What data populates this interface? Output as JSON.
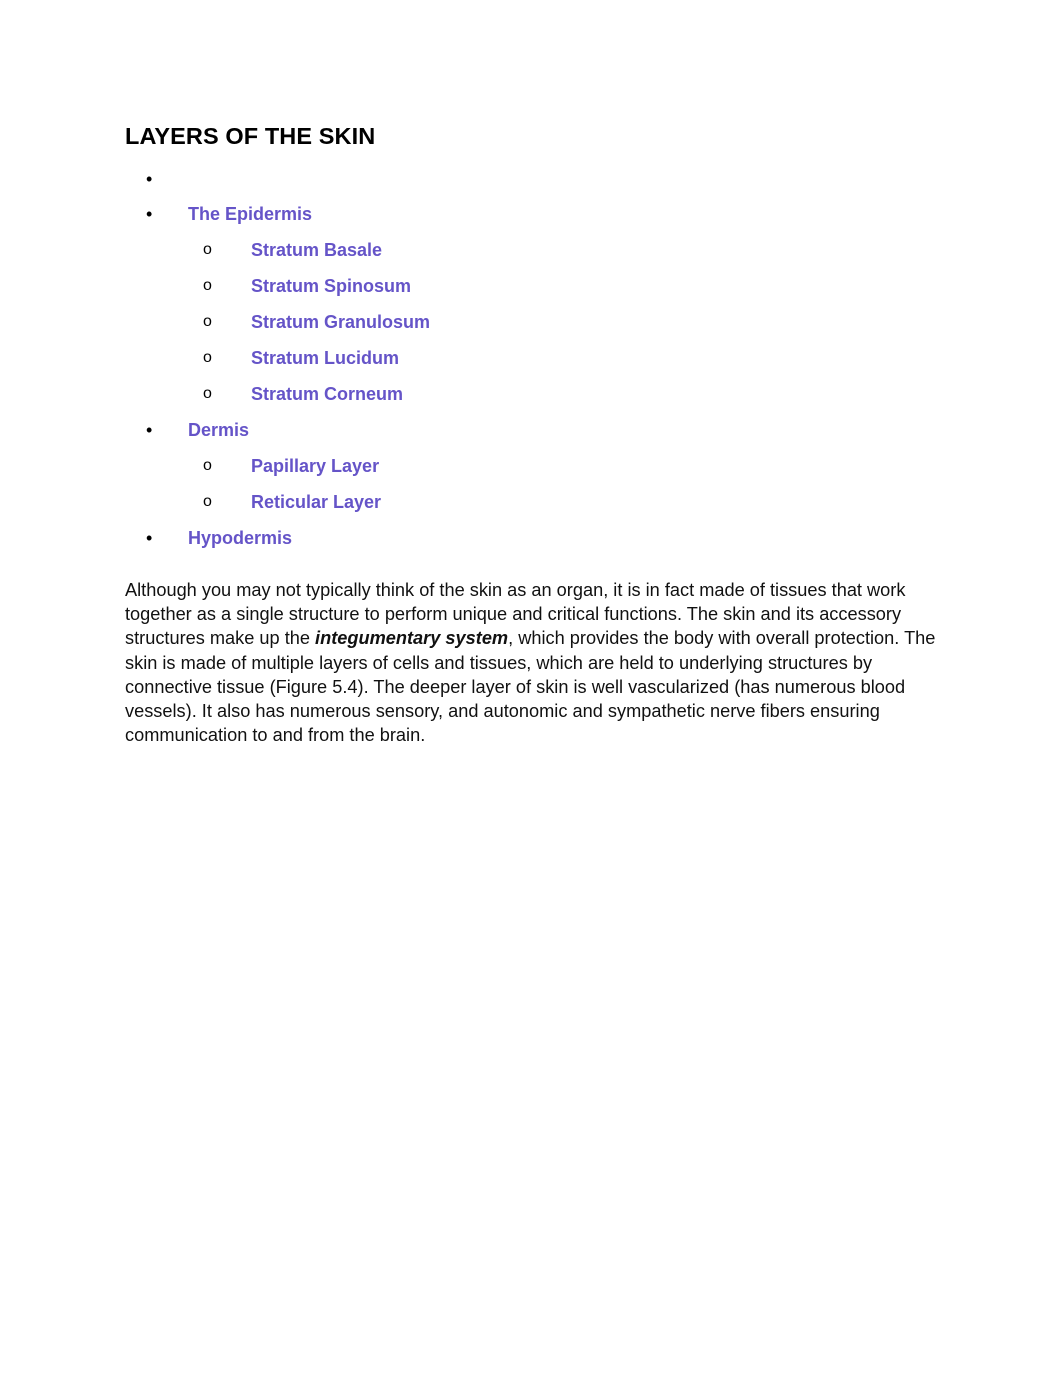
{
  "document": {
    "title": "LAYERS OF THE SKIN",
    "link_color": "#6554C8",
    "text_color": "#111111"
  },
  "outline": {
    "items": [
      {
        "marker": "•",
        "label": "",
        "is_link": false,
        "children": []
      },
      {
        "marker": "•",
        "label": "The Epidermis",
        "is_link": true,
        "children": [
          {
            "marker": "o",
            "label": "Stratum Basale"
          },
          {
            "marker": "o",
            "label": "Stratum Spinosum"
          },
          {
            "marker": "o",
            "label": "Stratum Granulosum"
          },
          {
            "marker": "o",
            "label": "Stratum Lucidum"
          },
          {
            "marker": "o",
            "label": "Stratum Corneum"
          }
        ]
      },
      {
        "marker": "•",
        "label": "Dermis",
        "is_link": true,
        "children": [
          {
            "marker": "o",
            "label": "Papillary Layer"
          },
          {
            "marker": "o",
            "label": "Reticular Layer"
          }
        ]
      },
      {
        "marker": "•",
        "label": "Hypodermis",
        "is_link": true,
        "children": []
      }
    ]
  },
  "paragraph": {
    "part1": "Although you may not typically think of the skin as an organ, it is in fact made of tissues that work together as a single structure to perform unique and critical functions. The skin and its accessory structures make up the ",
    "emphasis": "integumentary system",
    "part2": ", which provides the body with overall protection. The skin is made of multiple layers of cells and tissues, which are held to underlying structures by connective tissue (Figure 5.4). The deeper layer of skin is well vascularized (has numerous blood vessels). It also has numerous sensory, and autonomic and sympathetic nerve fibers ensuring communication to and from the brain."
  }
}
